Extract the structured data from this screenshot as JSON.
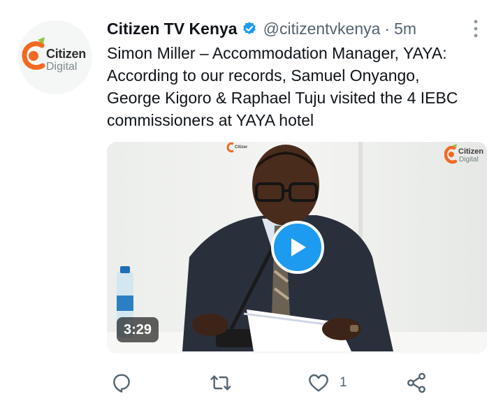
{
  "tweet": {
    "display_name": "Citizen TV Kenya",
    "handle": "@citizentvkenya",
    "separator": "·",
    "timestamp": "5m",
    "verified": true,
    "text_lines": [
      "Simon Miller – Accommodation Manager, YAYA:",
      "According to our records, Samuel Onyango,",
      "George Kigoro & Raphael Tuju visited the 4 IEBC",
      "commissioners at YAYA hotel"
    ]
  },
  "avatar": {
    "logo_line1": "Citizen",
    "logo_line2": "Digital"
  },
  "media": {
    "type": "video",
    "duration": "3:29",
    "watermark_line1": "Citizen",
    "watermark_line2": "Digital"
  },
  "actions": {
    "reply_icon": "reply-icon",
    "retweet_icon": "retweet-icon",
    "like_icon": "heart-icon",
    "like_count": "1",
    "share_icon": "share-icon"
  },
  "colors": {
    "accent": "#1d9bf0",
    "secondary_text": "#536471",
    "primary_text": "#0f1419",
    "brand_orange": "#f26a21",
    "brand_green": "#8cc63f"
  }
}
